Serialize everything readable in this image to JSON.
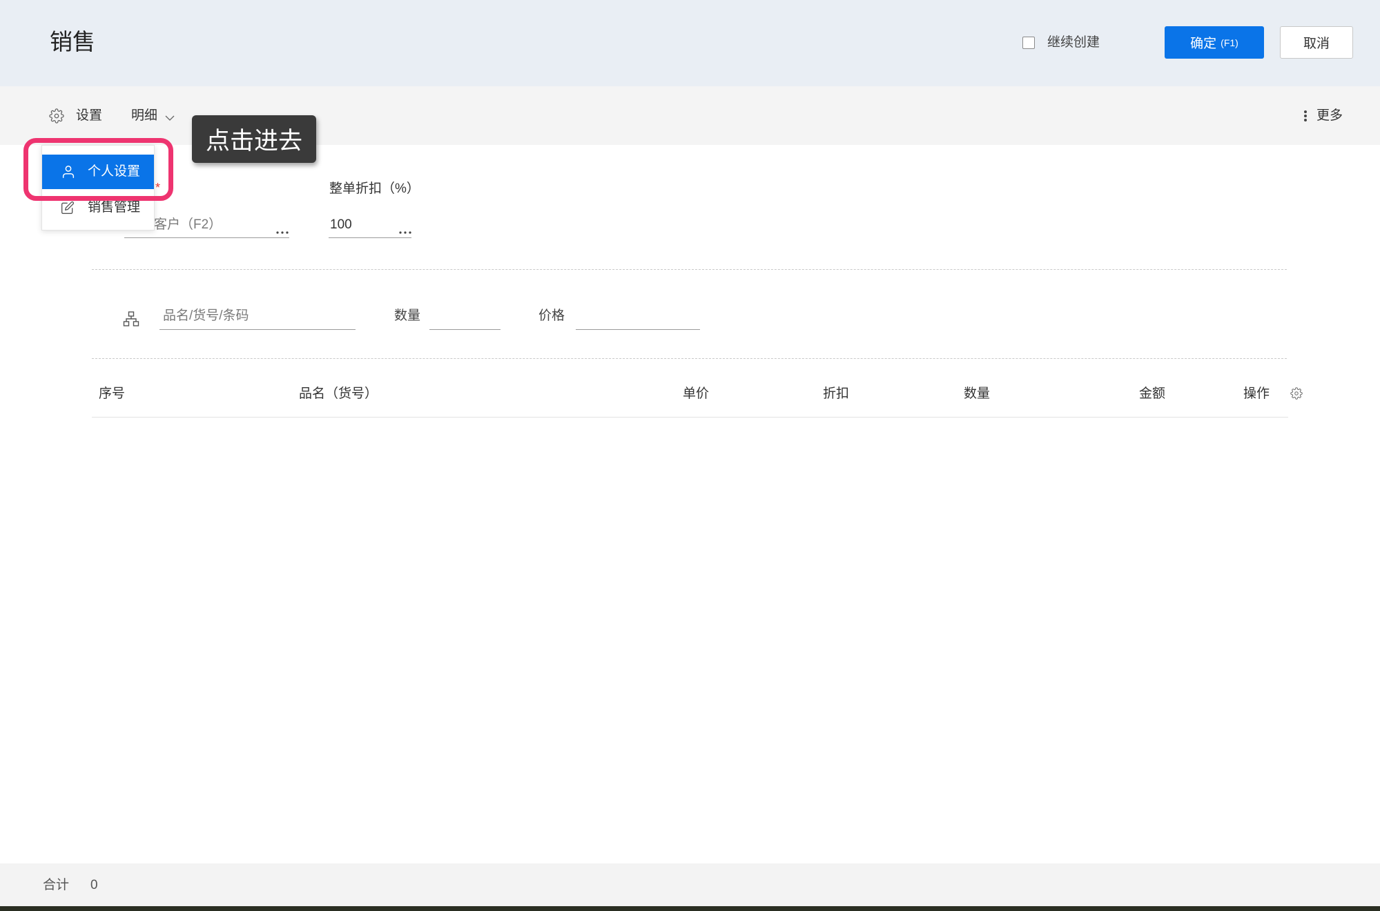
{
  "header": {
    "title": "销售",
    "continue_create_label": "继续创建",
    "continue_create_checked": false,
    "confirm_label": "确定",
    "confirm_shortcut": "(F1)",
    "cancel_label": "取消"
  },
  "toolbar": {
    "settings_icon": "gear-icon",
    "settings_label": "设置",
    "detail_label": "明细",
    "detail_icon": "chevron-down-icon",
    "more_icon": "vertical-dots-icon",
    "more_label": "更多"
  },
  "settings_menu": {
    "items": [
      {
        "label": "个人设置",
        "icon": "user-icon",
        "active": true
      },
      {
        "label": "销售管理",
        "icon": "edit-icon",
        "active": false
      }
    ]
  },
  "tooltip": {
    "text": "点击进去"
  },
  "form": {
    "customer": {
      "required_mark": "*",
      "placeholder": "客户（F2）",
      "picker_icon": "ellipsis-icon"
    },
    "discount": {
      "label": "整单折扣（%）",
      "value": "100",
      "picker_icon": "ellipsis-icon"
    }
  },
  "product_entry": {
    "icon": "hierarchy-icon",
    "search_placeholder": "品名/货号/条码",
    "qty_label": "数量",
    "qty_value": "",
    "price_label": "价格",
    "price_value": ""
  },
  "table": {
    "columns": [
      "序号",
      "品名（货号）",
      "单价",
      "折扣",
      "数量",
      "金额",
      "操作"
    ],
    "settings_icon": "gear-icon",
    "rows": []
  },
  "footer": {
    "total_label": "合计",
    "total_value": "0"
  },
  "colors": {
    "primary": "#0a74e8",
    "highlight": "#ee3470",
    "header_bg": "#e9eef4",
    "tooltip_bg": "#3a3a3a"
  }
}
